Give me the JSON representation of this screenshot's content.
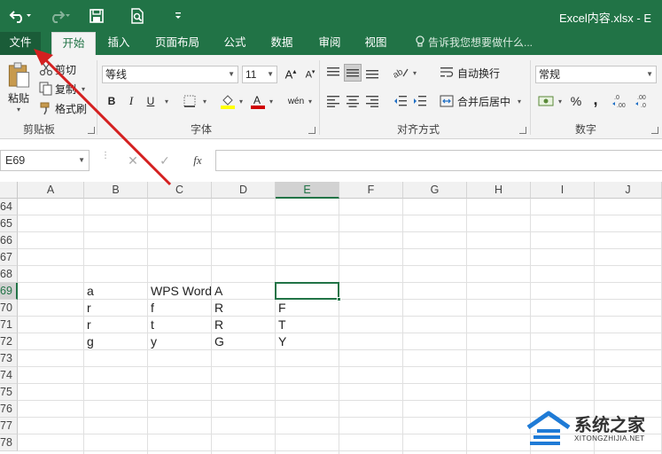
{
  "app": {
    "title": "Excel内容.xlsx - E",
    "accent": "#217346"
  },
  "qat": {
    "undo_icon": "undo-icon",
    "redo_icon": "redo-icon",
    "save_icon": "save-icon",
    "print_preview_icon": "print-preview-icon",
    "customize_icon": "customize-qat-icon"
  },
  "tabs": [
    {
      "label": "文件"
    },
    {
      "label": "开始"
    },
    {
      "label": "插入"
    },
    {
      "label": "页面布局"
    },
    {
      "label": "公式"
    },
    {
      "label": "数据"
    },
    {
      "label": "审阅"
    },
    {
      "label": "视图"
    }
  ],
  "tellme": "告诉我您想要做什么...",
  "clipboard": {
    "paste": "粘贴",
    "cut": "剪切",
    "copy": "复制",
    "format_painter": "格式刷",
    "group": "剪贴板"
  },
  "font": {
    "name": "等线",
    "size": "11",
    "bold": "B",
    "italic": "I",
    "underline": "U",
    "phonetic": "wén",
    "group": "字体"
  },
  "alignment": {
    "wrap": "自动换行",
    "merge": "合并后居中",
    "group": "对齐方式"
  },
  "number": {
    "format": "常规",
    "percent": "%",
    "comma": ",",
    "group": "数字"
  },
  "formula_bar": {
    "name_box": "E69",
    "fx": "fx",
    "value": ""
  },
  "columns": [
    "A",
    "B",
    "C",
    "D",
    "E",
    "F",
    "G",
    "H",
    "I",
    "J"
  ],
  "rows": [
    "64",
    "65",
    "66",
    "67",
    "68",
    "69",
    "70",
    "71",
    "72",
    "73",
    "74",
    "75",
    "76",
    "77",
    "78"
  ],
  "cells": {
    "r69": {
      "B": "a",
      "C": "WPS Word",
      "D": "A"
    },
    "r70": {
      "B": "r",
      "C": "f",
      "D": "R",
      "E": "F"
    },
    "r71": {
      "B": "r",
      "C": "t",
      "D": "R",
      "E": "T"
    },
    "r72": {
      "B": "g",
      "C": "y",
      "D": "G",
      "E": "Y"
    }
  },
  "selection": {
    "column": "E",
    "row": "69"
  },
  "watermark": {
    "name": "系统之家",
    "url": "XITONGZHIJIA.NET"
  }
}
